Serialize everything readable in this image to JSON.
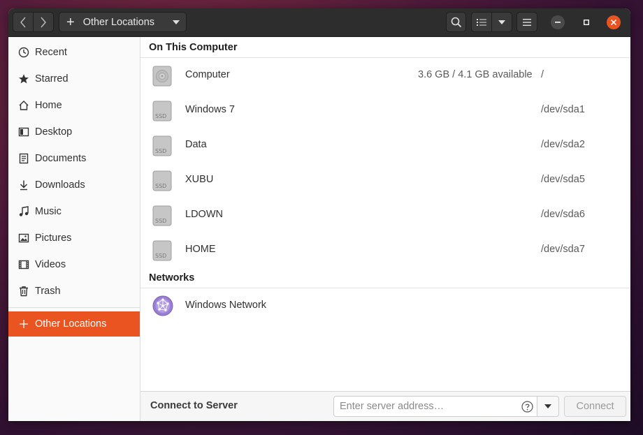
{
  "window": {
    "path_label": "Other Locations"
  },
  "sidebar": {
    "items": [
      {
        "label": "Recent",
        "icon": "clock-icon"
      },
      {
        "label": "Starred",
        "icon": "star-icon"
      },
      {
        "label": "Home",
        "icon": "home-icon"
      },
      {
        "label": "Desktop",
        "icon": "desktop-icon"
      },
      {
        "label": "Documents",
        "icon": "document-icon"
      },
      {
        "label": "Downloads",
        "icon": "download-icon"
      },
      {
        "label": "Music",
        "icon": "music-icon"
      },
      {
        "label": "Pictures",
        "icon": "picture-icon"
      },
      {
        "label": "Videos",
        "icon": "video-icon"
      },
      {
        "label": "Trash",
        "icon": "trash-icon"
      }
    ],
    "other_locations": {
      "label": "Other Locations",
      "icon": "plus-icon",
      "selected": true
    },
    "accent_color": "#e95420"
  },
  "main": {
    "on_this_computer": {
      "title": "On This Computer",
      "drives": [
        {
          "name": "Computer",
          "available": "3.6 GB / 4.1 GB available",
          "path": "/",
          "icon": "harddisk-icon"
        },
        {
          "name": "Windows 7",
          "available": "",
          "path": "/dev/sda1",
          "icon": "ssd-icon"
        },
        {
          "name": "Data",
          "available": "",
          "path": "/dev/sda2",
          "icon": "ssd-icon"
        },
        {
          "name": "XUBU",
          "available": "",
          "path": "/dev/sda5",
          "icon": "ssd-icon"
        },
        {
          "name": "LDOWN",
          "available": "",
          "path": "/dev/sda6",
          "icon": "ssd-icon"
        },
        {
          "name": "HOME",
          "available": "",
          "path": "/dev/sda7",
          "icon": "ssd-icon"
        }
      ],
      "ssd_text": "SSD"
    },
    "networks": {
      "title": "Networks",
      "items": [
        {
          "name": "Windows Network",
          "icon": "network-icon"
        }
      ]
    }
  },
  "connect_bar": {
    "label": "Connect to Server",
    "placeholder": "Enter server address…",
    "button_label": "Connect",
    "button_enabled": false
  }
}
